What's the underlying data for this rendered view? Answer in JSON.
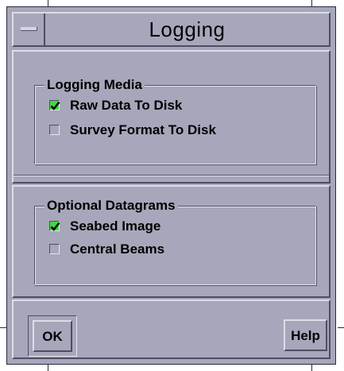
{
  "window": {
    "title": "Logging",
    "colors": {
      "background": "#a7a7bb",
      "check_fill": "#3edc3e"
    },
    "menu_icon": "window-menu-icon"
  },
  "logging_media": {
    "label": "Logging Media",
    "options": [
      {
        "label": "Raw Data To Disk",
        "checked": true
      },
      {
        "label": "Survey Format To Disk",
        "checked": false
      }
    ]
  },
  "optional_datagrams": {
    "label": "Optional Datagrams",
    "options": [
      {
        "label": "Seabed Image",
        "checked": true
      },
      {
        "label": "Central Beams",
        "checked": false
      }
    ]
  },
  "buttons": {
    "ok_label": "OK",
    "help_label": "Help"
  }
}
